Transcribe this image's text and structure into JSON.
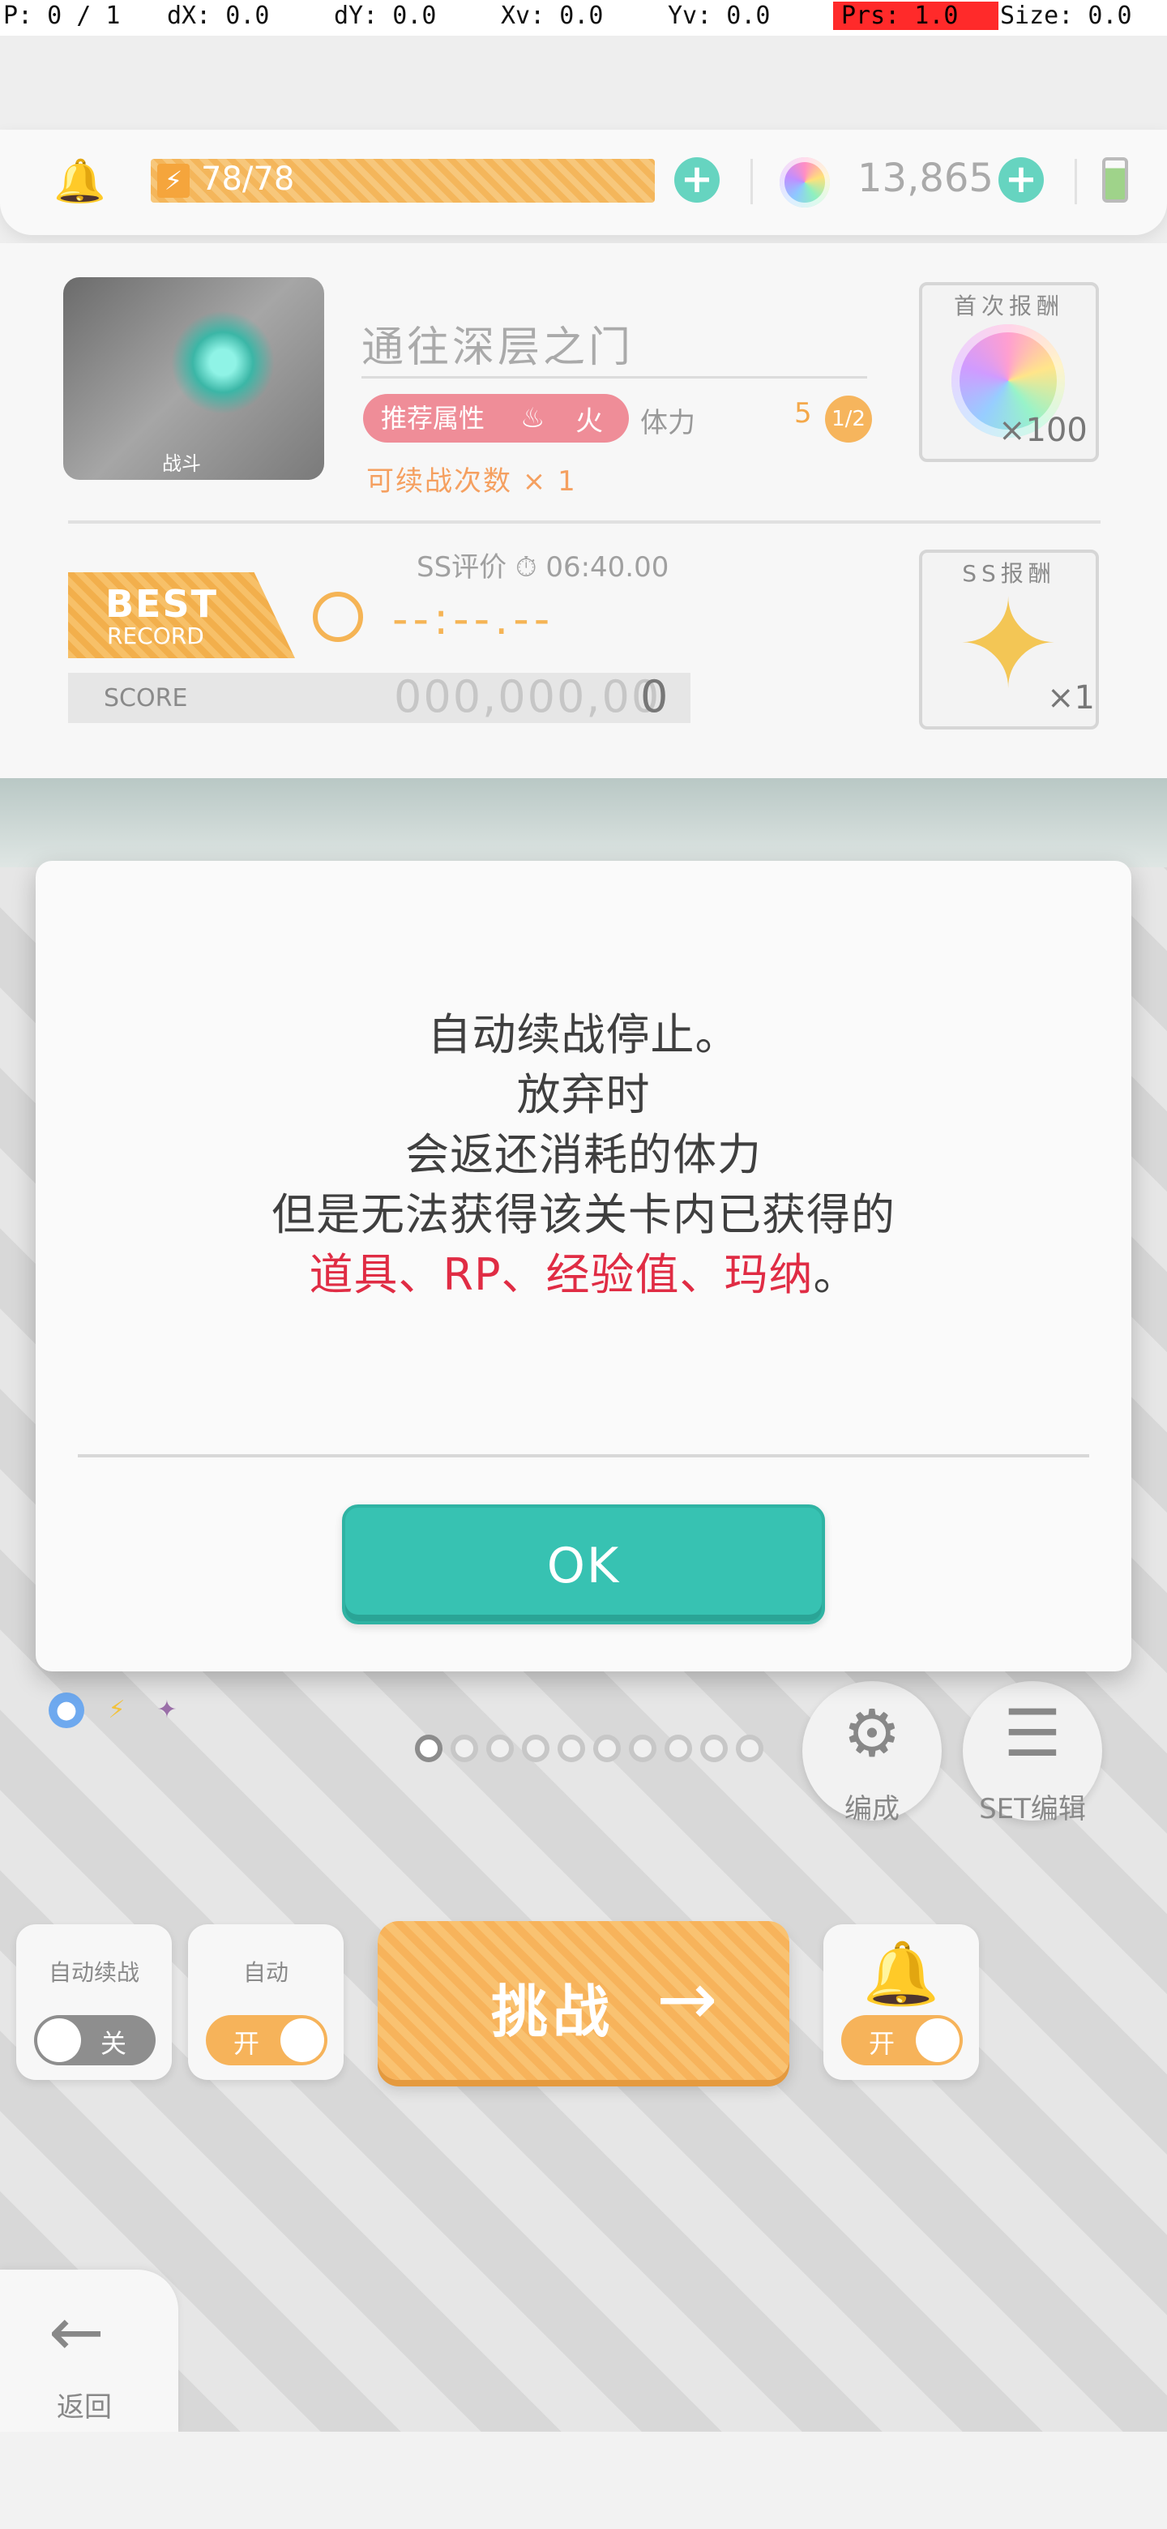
{
  "debug": {
    "p": "P: 0 / 1",
    "dx": "dX: 0.0",
    "dy": "dY: 0.0",
    "xv": "Xv: 0.0",
    "yv": "Yv: 0.0",
    "prs": "Prs: 1.0",
    "size": "Size: 0.0"
  },
  "resources": {
    "stamina": "78/78",
    "gems": "13,865",
    "stamina_fill_fraction": 1.0,
    "battery_fill_fraction": 0.8
  },
  "quest": {
    "thumb_label": "战斗",
    "title": "通往深层之门",
    "attr_label": "推荐属性",
    "attr_value": "火",
    "stamina_label": "体力",
    "stamina_cost": "5",
    "stamina_half": "1/2",
    "continue_count": "可续战次数 × 1",
    "first_reward_label": "首次报酬",
    "first_reward_qty": "×100",
    "ss_rank": "SS评价",
    "ss_time": "06:40.00",
    "best_label": "BEST",
    "record_label": "RECORD",
    "best_time": "--:--.--",
    "score_label": "SCORE",
    "score_value": "000,000,00",
    "score_value_last": "0",
    "ss_reward_label": "SS报酬",
    "ss_reward_qty": "×1"
  },
  "modal": {
    "line1": "自动续战停止。",
    "line2": "放弃时",
    "line3": "会返还消耗的体力",
    "line4": "但是无法获得该关卡内已获得的",
    "line5_red": "道具、RP、经验值、玛纳",
    "line5_tail": "。",
    "ok_label": "OK"
  },
  "controls": {
    "formation_label": "编成",
    "set_edit_label": "SET编辑",
    "auto_continue_label": "自动续战",
    "auto_continue_state": "关",
    "auto_label": "自动",
    "auto_state": "开",
    "challenge_label": "挑战",
    "notify_state": "开",
    "back_label": "返回",
    "page_count": 10,
    "active_page": 1
  },
  "colors": {
    "accent_teal": "#37c2b2",
    "accent_orange": "#f6b35a",
    "warning_red": "#e02c44"
  },
  "icons": [
    "bell-icon",
    "bolt-icon",
    "plus-icon",
    "gem-icon",
    "battery-icon",
    "fire-icon",
    "timer-icon",
    "arrow-right-icon",
    "arrow-left-icon",
    "gear-icon",
    "list-icon"
  ]
}
